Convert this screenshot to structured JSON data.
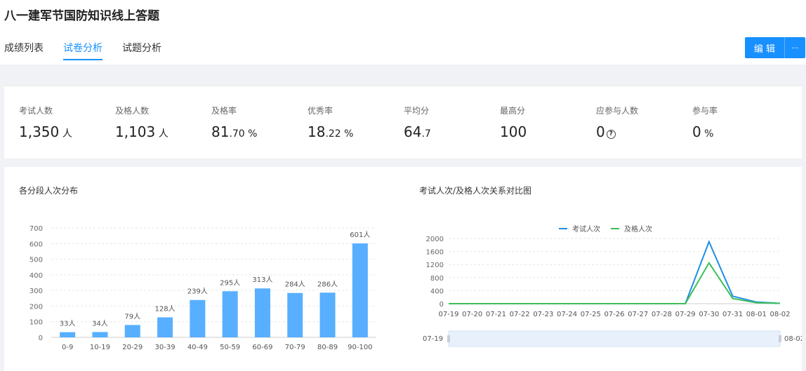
{
  "header": {
    "title": "八一建军节国防知识线上答题",
    "tabs": [
      {
        "label": "成绩列表"
      },
      {
        "label": "试卷分析"
      },
      {
        "label": "试题分析"
      }
    ],
    "edit_label": "编 辑",
    "more_label": "···"
  },
  "stats": [
    {
      "label": "考试人数",
      "value": "1,350",
      "unit": " 人"
    },
    {
      "label": "及格人数",
      "value": "1,103",
      "unit": " 人"
    },
    {
      "label": "及格率",
      "value": "81",
      "unit": ".70 %"
    },
    {
      "label": "优秀率",
      "value": "18",
      "unit": ".22 %"
    },
    {
      "label": "平均分",
      "value": "64",
      "unit": ".7"
    },
    {
      "label": "最高分",
      "value": "100",
      "unit": ""
    },
    {
      "label": "应参与人数",
      "value": "0",
      "unit": ""
    },
    {
      "label": "参与率",
      "value": "0",
      "unit": " %"
    }
  ],
  "icons": {
    "help": "question-circle-icon"
  },
  "colors": {
    "accent": "#1890ff",
    "bar": "#58afff",
    "line1": "#1f8ee5",
    "line2": "#3dbf5a"
  },
  "chart_data": [
    {
      "type": "bar",
      "title": "各分段人次分布",
      "categories": [
        "0-9",
        "10-19",
        "20-29",
        "30-39",
        "40-49",
        "50-59",
        "60-69",
        "70-79",
        "80-89",
        "90-100"
      ],
      "values": [
        33,
        34,
        79,
        128,
        239,
        295,
        313,
        284,
        286,
        601
      ],
      "data_labels": [
        "33人",
        "34人",
        "79人",
        "128人",
        "239人",
        "295人",
        "313人",
        "284人",
        "286人",
        "601人"
      ],
      "yticks": [
        "0",
        "100",
        "200",
        "300",
        "400",
        "500",
        "600",
        "700"
      ],
      "ylim": [
        0,
        700
      ]
    },
    {
      "type": "line",
      "title": "考试人次/及格人次关系对比图",
      "categories": [
        "07-19",
        "07-20",
        "07-21",
        "07-22",
        "07-23",
        "07-24",
        "07-25",
        "07-26",
        "07-27",
        "07-28",
        "07-29",
        "07-30",
        "07-31",
        "08-01",
        "08-02"
      ],
      "series": [
        {
          "name": "考试人次",
          "values": [
            0,
            0,
            0,
            0,
            0,
            0,
            0,
            0,
            0,
            0,
            0,
            1900,
            230,
            50,
            10
          ]
        },
        {
          "name": "及格人次",
          "values": [
            0,
            0,
            0,
            0,
            0,
            0,
            0,
            0,
            0,
            0,
            0,
            1250,
            160,
            30,
            8
          ]
        }
      ],
      "yticks": [
        "0",
        "400",
        "800",
        "1200",
        "1600",
        "2000"
      ],
      "ylim": [
        0,
        2000
      ],
      "legend": "top-center",
      "slider": {
        "start_label": "07-19",
        "end_label": "08-02"
      }
    }
  ]
}
